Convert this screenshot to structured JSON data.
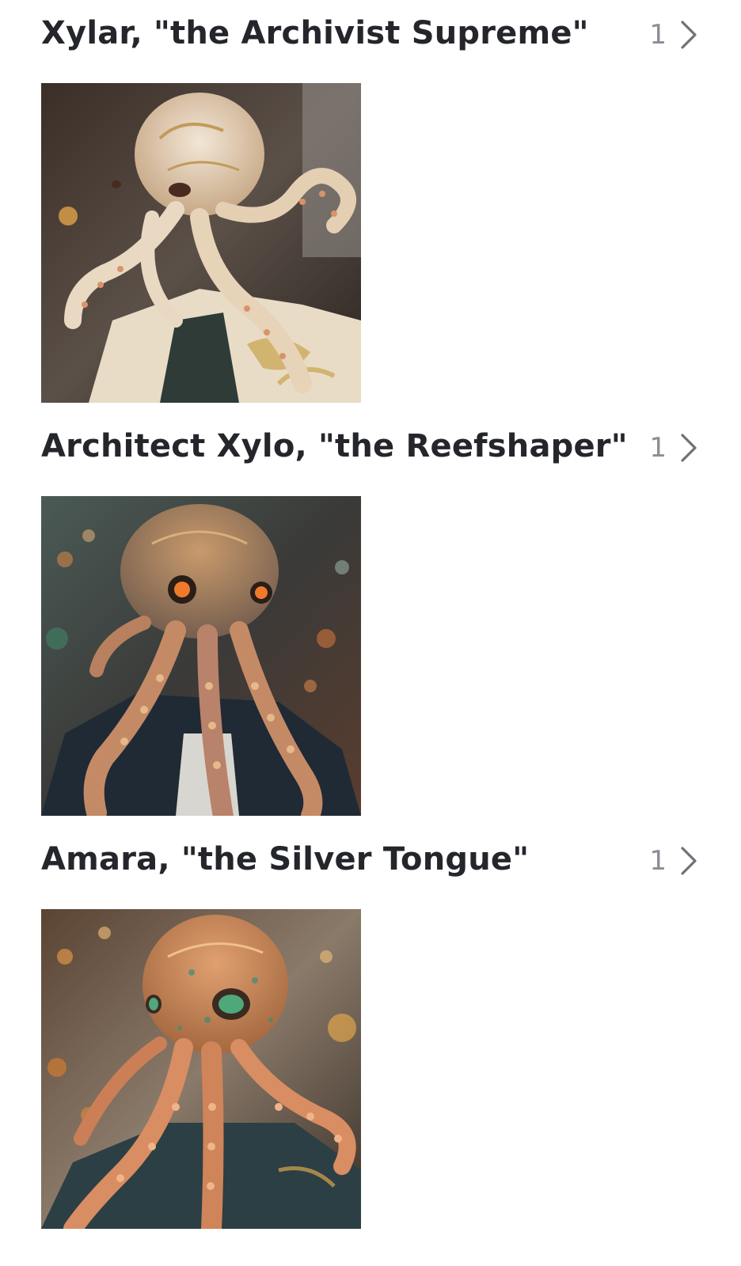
{
  "albums": [
    {
      "title": "Xylar, \"the Archivist Supreme\"",
      "count": "1",
      "image_subject": "octopus-headed figure in ornate white and gold coat"
    },
    {
      "title": "Architect Xylo, \"the Reefshaper\"",
      "count": "1",
      "image_subject": "octopus-headed figure with glowing orange eyes in dark suit"
    },
    {
      "title": "Amara, \"the Silver Tongue\"",
      "count": "1",
      "image_subject": "octopus-headed figure with green eyes in patterned jacket"
    }
  ],
  "icons": {
    "chevron": "chevron-right-icon"
  },
  "colors": {
    "title": "#24262c",
    "count": "#8a8d93",
    "background": "#ffffff"
  }
}
